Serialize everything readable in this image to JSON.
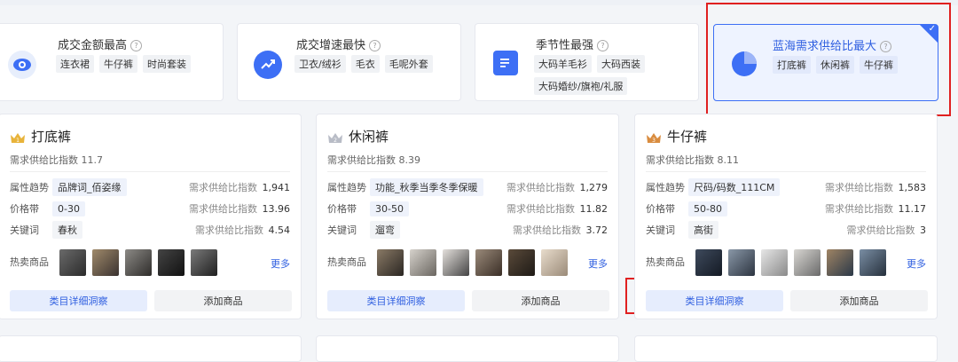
{
  "filters": [
    {
      "title": "成交金额最高",
      "tags": [
        "连衣裙",
        "牛仔裤",
        "时尚套装"
      ],
      "icon": "eye-icon"
    },
    {
      "title": "成交增速最快",
      "tags": [
        "卫衣/绒衫",
        "毛衣",
        "毛呢外套"
      ],
      "icon": "trend-up-icon"
    },
    {
      "title": "季节性最强",
      "tags": [
        "大码羊毛衫",
        "大码西装",
        "大码婚纱/旗袍/礼服"
      ],
      "icon": "document-icon"
    },
    {
      "title": "蓝海需求供给比最大",
      "tags": [
        "打底裤",
        "休闲裤",
        "牛仔裤"
      ],
      "icon": "pie-icon",
      "selected": true
    }
  ],
  "cards": [
    {
      "rank": "1",
      "name": "打底裤",
      "index_label": "需求供给比指数 11.7",
      "rows": [
        {
          "label": "属性趋势",
          "value": "品牌词_佰姿缘",
          "metric_label": "需求供给比指数",
          "metric_value": "1,941"
        },
        {
          "label": "价格带",
          "value": "0-30",
          "metric_label": "需求供给比指数",
          "metric_value": "13.96"
        },
        {
          "label": "关键词",
          "value": "春秋",
          "metric_label": "需求供给比指数",
          "metric_value": "4.54"
        }
      ],
      "hot_label": "热卖商品",
      "more_label": "更多",
      "primary_button": "类目详细洞察",
      "secondary_button": "添加商品"
    },
    {
      "rank": "2",
      "name": "休闲裤",
      "index_label": "需求供给比指数 8.39",
      "rows": [
        {
          "label": "属性趋势",
          "value": "功能_秋季当季冬季保暖",
          "metric_label": "需求供给比指数",
          "metric_value": "1,279"
        },
        {
          "label": "价格带",
          "value": "30-50",
          "metric_label": "需求供给比指数",
          "metric_value": "11.82"
        },
        {
          "label": "关键词",
          "value": "遛弯",
          "metric_label": "需求供给比指数",
          "metric_value": "3.72"
        }
      ],
      "hot_label": "热卖商品",
      "more_label": "更多",
      "primary_button": "类目详细洞察",
      "secondary_button": "添加商品"
    },
    {
      "rank": "3",
      "name": "牛仔裤",
      "index_label": "需求供给比指数 8.11",
      "rows": [
        {
          "label": "属性趋势",
          "value": "尺码/码数_111CM",
          "metric_label": "需求供给比指数",
          "metric_value": "1,583"
        },
        {
          "label": "价格带",
          "value": "50-80",
          "metric_label": "需求供给比指数",
          "metric_value": "11.17"
        },
        {
          "label": "关键词",
          "value": "高街",
          "metric_label": "需求供给比指数",
          "metric_value": "3"
        }
      ],
      "hot_label": "热卖商品",
      "more_label": "更多",
      "primary_button": "类目详细洞察",
      "secondary_button": "添加商品"
    }
  ],
  "colors": {
    "accent": "#2f5fe0",
    "highlight": "#e02020",
    "gold": "#e8b33a",
    "silver": "#b8bcc6",
    "bronze": "#d98c3f"
  }
}
